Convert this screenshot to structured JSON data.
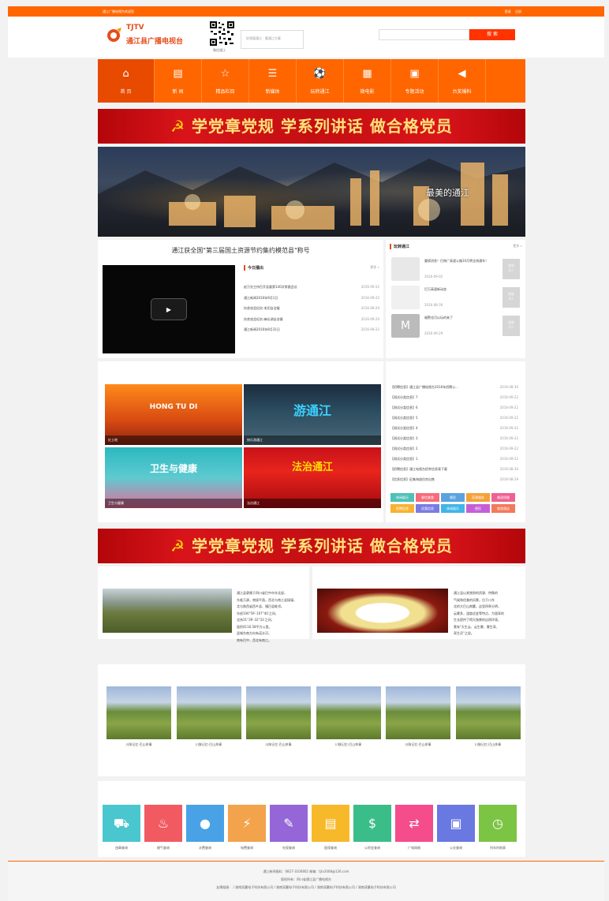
{
  "topbar": {
    "left": "通江广播电视台欢迎您",
    "login": "登录",
    "register": "注册"
  },
  "logo": {
    "line1": "TJTV",
    "line2": "通江县广播电视台"
  },
  "qr_caption": "微信通江",
  "slogan": "好视窗通江 · 看通江大事",
  "search": {
    "button": "搜 索"
  },
  "nav": [
    {
      "icon": "home-icon",
      "glyph": "⌂",
      "label": "首 页"
    },
    {
      "icon": "newspaper-icon",
      "glyph": "▤",
      "label": "新 闻"
    },
    {
      "icon": "star-icon",
      "glyph": "☆",
      "label": "精品栏目"
    },
    {
      "icon": "media-icon",
      "glyph": "☰",
      "label": "新媒体"
    },
    {
      "icon": "ball-icon",
      "glyph": "⚽",
      "label": "玩转通江"
    },
    {
      "icon": "film-icon",
      "glyph": "▦",
      "label": "微电影"
    },
    {
      "icon": "calendar-icon",
      "glyph": "▣",
      "label": "专题活动"
    },
    {
      "icon": "megaphone-icon",
      "glyph": "◀",
      "label": "台奖爆料"
    }
  ],
  "banner": {
    "text": "学党章党规 学系列讲话 做合格党员"
  },
  "hero": {
    "caption": "最美的通江"
  },
  "headline": "通江获全国\"第三届国土资源节约集约模范县\"称号",
  "today": {
    "title": "今日播出",
    "more": "更多 »",
    "items": [
      {
        "title": "赵万先主持召开县委第140次常委会议",
        "date": "2016-09-22"
      },
      {
        "title": "通江新闻2016年9月1日",
        "date": "2016-09-22"
      },
      {
        "title": "扶贫攻坚纪实-毛切自治镇",
        "date": "2016-09-20"
      },
      {
        "title": "扶贫攻坚纪实-麻长湖自治镇",
        "date": "2016-09-20"
      },
      {
        "title": "通江新闻2016年8月31日",
        "date": "2016-09-22"
      }
    ]
  },
  "fun": {
    "title": "玩转通江",
    "more": "更多 »",
    "items": [
      {
        "title": "重磅消息！巴南广高速公路10月将全线通车！",
        "date": "2016-09-02",
        "badge": "浏览\n2人"
      },
      {
        "title": "巴万高速新动态",
        "date": "2016-08-30",
        "badge": "浏览\n4人"
      },
      {
        "title": "福警也可以玩的来了",
        "date": "2016-09-29",
        "badge": "浏览\n1人"
      }
    ]
  },
  "tiles": [
    {
      "title": "HONG TU DI",
      "caption": "红土地"
    },
    {
      "title": "游通江",
      "caption": "快乐游通江"
    },
    {
      "title": "卫生与健康",
      "caption": "卫生与健康"
    },
    {
      "title": "法治通江",
      "caption": "法治通江"
    }
  ],
  "notices": [
    {
      "title": "【招聘信息】通江县广播电视台2016年招聘公...",
      "date": "2016-08-30"
    },
    {
      "title": "【测试分类信息】7",
      "date": "2016-09-22"
    },
    {
      "title": "【测试分类信息】6",
      "date": "2016-09-22"
    },
    {
      "title": "【测试分类信息】5",
      "date": "2016-09-22"
    },
    {
      "title": "【测试分类信息】4",
      "date": "2016-09-22"
    },
    {
      "title": "【测试分类信息】3",
      "date": "2016-09-22"
    },
    {
      "title": "【测试分类信息】2",
      "date": "2016-09-22"
    },
    {
      "title": "【测试分类信息】1",
      "date": "2016-09-22"
    },
    {
      "title": "【招聘信息】通江电视台招考信息表下载",
      "date": "2016-08-30"
    },
    {
      "title": "【信息信息】征集海拔住房出售",
      "date": "2016-08-29"
    }
  ],
  "tags": [
    {
      "label": "休闲娱乐",
      "color": "#4fc1b6"
    },
    {
      "label": "餐饮美食",
      "color": "#f76c7b"
    },
    {
      "label": "便民",
      "color": "#5aa3e0"
    },
    {
      "label": "家政服务",
      "color": "#f5a13b"
    },
    {
      "label": "美容保健",
      "color": "#f06090"
    },
    {
      "label": "招聘信息",
      "color": "#f8b232"
    },
    {
      "label": "优惠信息",
      "color": "#7b7ce3"
    },
    {
      "label": "休闲娱乐",
      "color": "#41b5e8"
    },
    {
      "label": "便民",
      "color": "#c55fd8"
    },
    {
      "label": "旅游酒店",
      "color": "#f27a5a"
    }
  ],
  "intro": {
    "left": [
      "通江县隶属于四川省巴中市东北部，",
      "东临万源，南接平昌，西北与南江县接壤，",
      "北与陕西省西乡县、镇巴县毗邻。",
      "东经106°59′-107°40′之间，",
      "北纬31°39′-32°33′之间，",
      "面积4116.58平方公里。",
      "县城东南方向有诺水河，",
      "南有巴中，西北有南江。"
    ],
    "right": [
      "通江县以其独到的资源、特殊的",
      "气候和优美的风景，位于川东",
      "北的大巴山南麓，这里四季分明，",
      "云雾多，湿度适宜等特点，为银耳的",
      "生长提供了得天独厚的自然环境，",
      "素有\"天生云、云生雾、雾生耳、",
      "耳生灵\"之说。"
    ]
  },
  "gallery": [
    {
      "caption": "川陕记忆·巴山茶事"
    },
    {
      "caption": "川陕记忆·巴山茶事"
    },
    {
      "caption": "川陕记忆·巴山茶事"
    },
    {
      "caption": "川陕记忆·巴山茶事"
    },
    {
      "caption": "川陕记忆·巴山茶事"
    },
    {
      "caption": "川陕记忆·巴山茶事"
    }
  ],
  "services": [
    {
      "icon": "car-icon",
      "glyph": "⛟",
      "label": "违章查询",
      "color": "#4ac6cf"
    },
    {
      "icon": "flame-icon",
      "glyph": "♨",
      "label": "燃气查询",
      "color": "#f25a62"
    },
    {
      "icon": "water-icon",
      "glyph": "●",
      "label": "水费查询",
      "color": "#4aa2e6"
    },
    {
      "icon": "plug-icon",
      "glyph": "⚡",
      "label": "电费查询",
      "color": "#f3a34b"
    },
    {
      "icon": "edit-icon",
      "glyph": "✎",
      "label": "社保查询",
      "color": "#9466d8"
    },
    {
      "icon": "id-icon",
      "glyph": "▤",
      "label": "医保查询",
      "color": "#f7b92a"
    },
    {
      "icon": "money-icon",
      "glyph": "$",
      "label": "公积金查询",
      "color": "#3bbd8a"
    },
    {
      "icon": "shuffle-icon",
      "glyph": "⇄",
      "label": "广电网络",
      "color": "#f54c8c"
    },
    {
      "icon": "bus-icon",
      "glyph": "▣",
      "label": "公交查询",
      "color": "#6a78e2"
    },
    {
      "icon": "clock-icon",
      "glyph": "◷",
      "label": "列车时刻表",
      "color": "#7cc444"
    }
  ],
  "footer": {
    "line1": "通江新闻报料：0827-3100802 邮箱：tjtv2008@126.com",
    "line2": "版权所有：四川省通江县广播电视台",
    "line3": "友情链接： / 湖南双赢电子科技有限公司 / 湖南双赢电子科技有限公司 / 湖南双赢电子科技有限公司 / 湖南双赢电子科技有限公司"
  }
}
